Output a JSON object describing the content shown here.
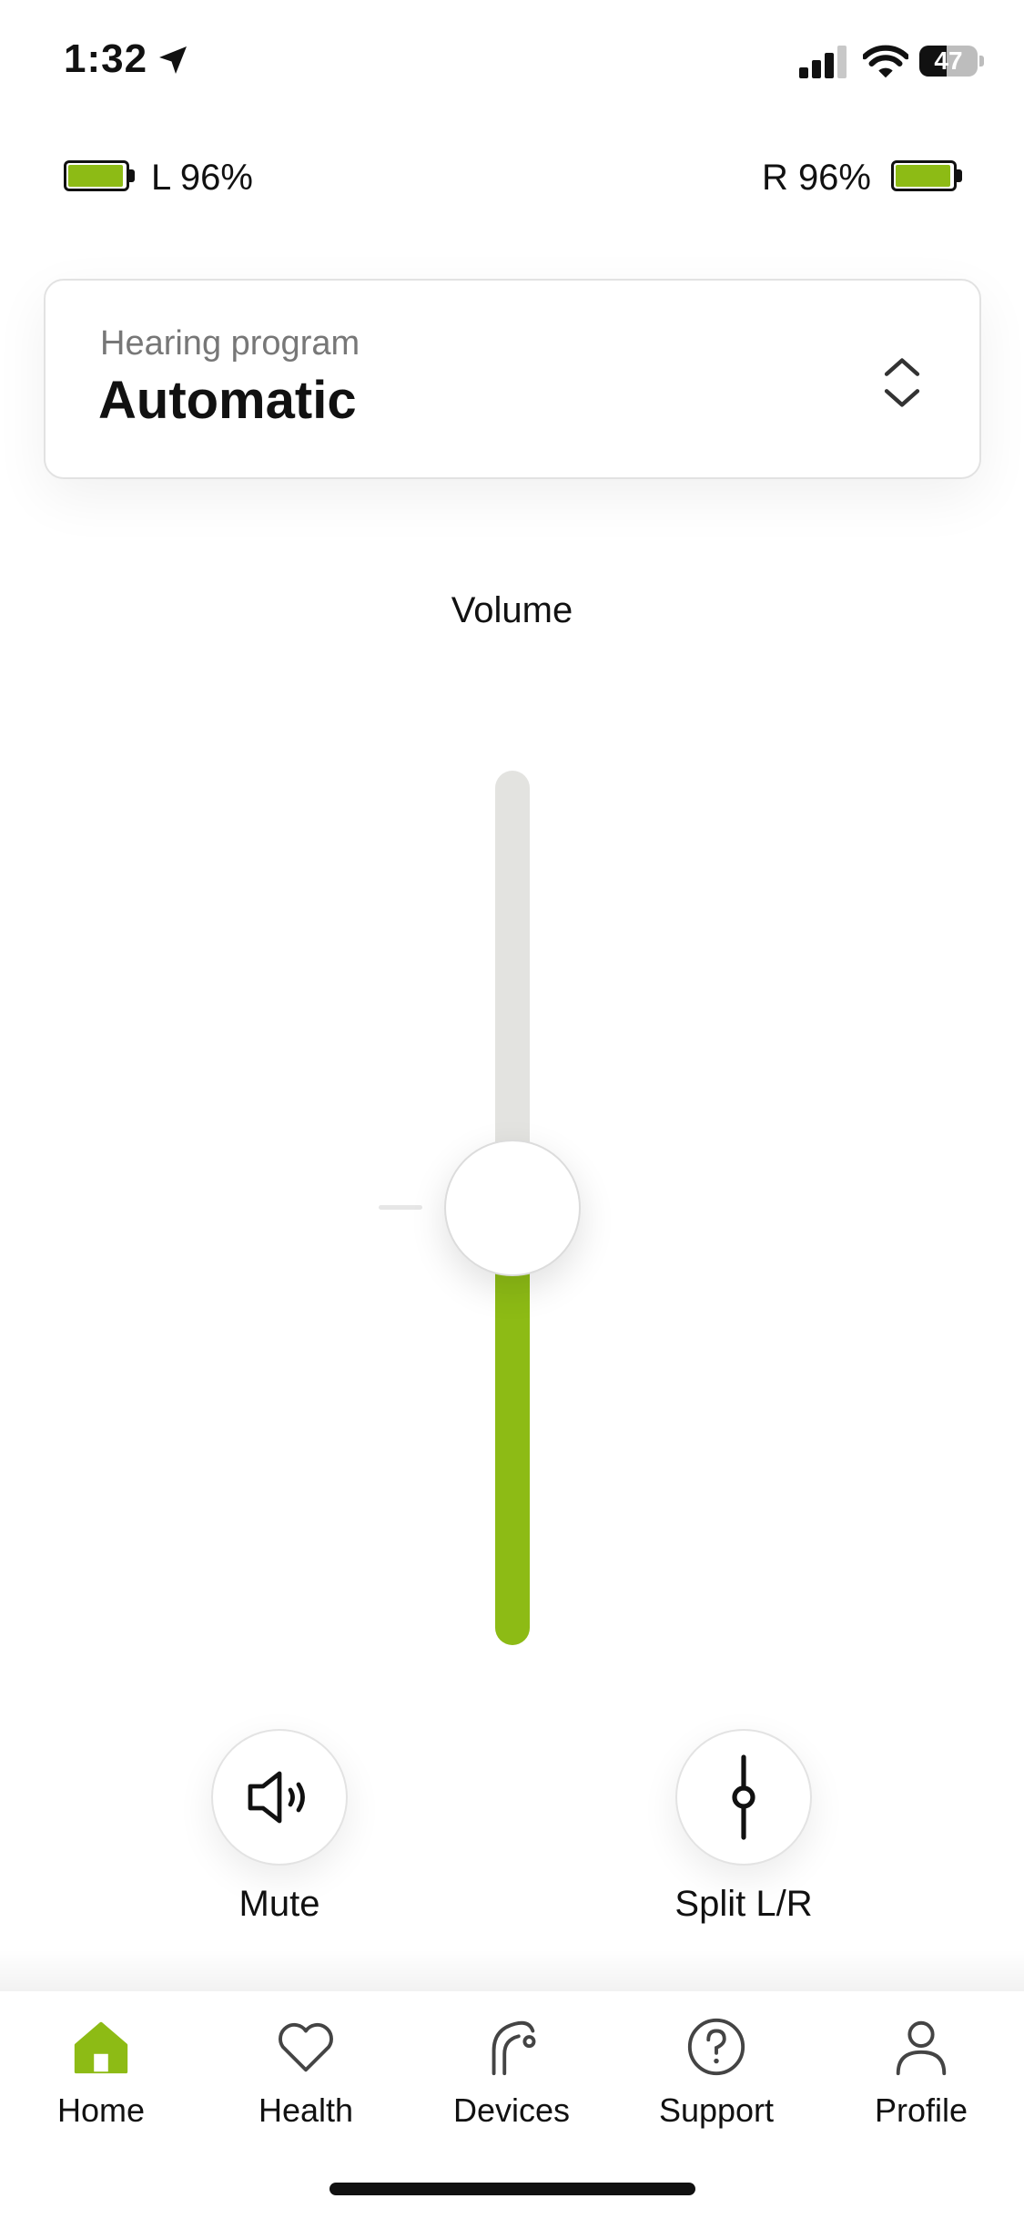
{
  "status_bar": {
    "time": "1:32",
    "battery_percent": "47"
  },
  "hearing_aids": {
    "left": {
      "label": "L 96%",
      "level": 0.96
    },
    "right": {
      "label": "R 96%",
      "level": 0.96
    }
  },
  "program": {
    "label": "Hearing program",
    "value": "Automatic"
  },
  "volume": {
    "title": "Volume",
    "level": 0.5
  },
  "actions": {
    "mute": "Mute",
    "split": "Split L/R"
  },
  "nav": {
    "items": [
      {
        "label": "Home",
        "icon": "home-icon",
        "active": true
      },
      {
        "label": "Health",
        "icon": "heart-icon",
        "active": false
      },
      {
        "label": "Devices",
        "icon": "hearing-aid-icon",
        "active": false
      },
      {
        "label": "Support",
        "icon": "question-icon",
        "active": false
      },
      {
        "label": "Profile",
        "icon": "person-icon",
        "active": false
      }
    ]
  },
  "colors": {
    "accent": "#8dbb15",
    "track": "#e3e3e0",
    "text": "#111111",
    "muted": "#777777"
  }
}
